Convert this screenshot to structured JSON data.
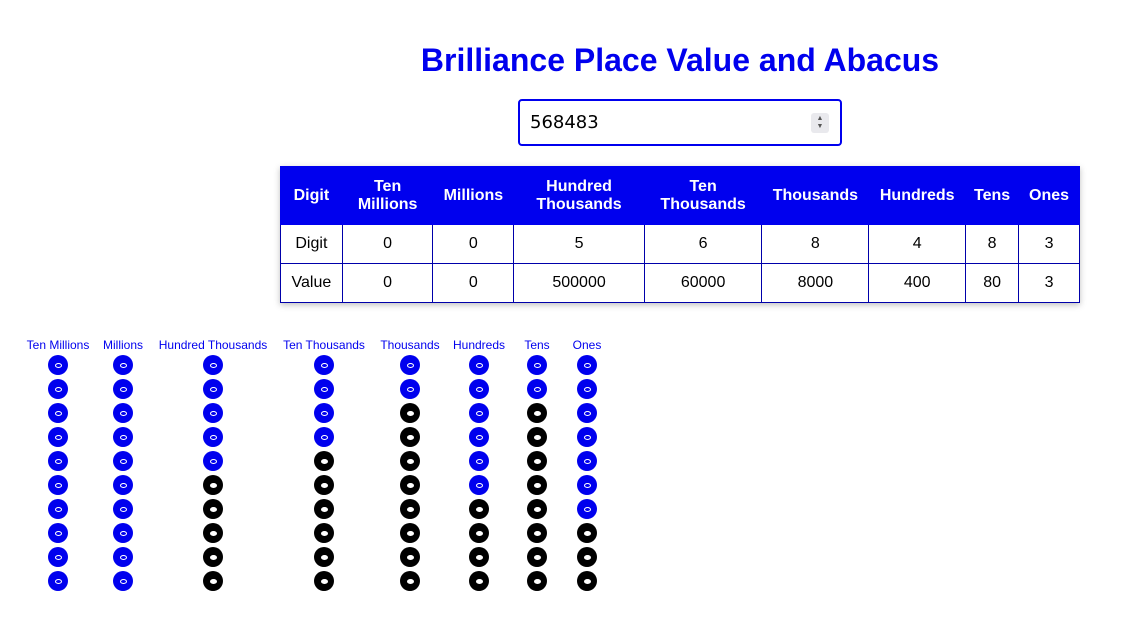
{
  "title": "Brilliance Place Value and Abacus",
  "input": {
    "value": "568483"
  },
  "table": {
    "headers": [
      "Digit",
      "Ten Millions",
      "Millions",
      "Hundred Thousands",
      "Ten Thousands",
      "Thousands",
      "Hundreds",
      "Tens",
      "Ones"
    ],
    "rows": [
      {
        "label": "Digit",
        "cells": [
          "0",
          "0",
          "5",
          "6",
          "8",
          "4",
          "8",
          "3"
        ]
      },
      {
        "label": "Value",
        "cells": [
          "0",
          "0",
          "500000",
          "60000",
          "8000",
          "400",
          "80",
          "3"
        ]
      }
    ]
  },
  "abacus": {
    "beads_per_column": 10,
    "columns": [
      {
        "label": "Ten Millions",
        "digit": 0
      },
      {
        "label": "Millions",
        "digit": 0
      },
      {
        "label": "Hundred Thousands",
        "digit": 5
      },
      {
        "label": "Ten Thousands",
        "digit": 6
      },
      {
        "label": "Thousands",
        "digit": 8
      },
      {
        "label": "Hundreds",
        "digit": 4
      },
      {
        "label": "Tens",
        "digit": 8
      },
      {
        "label": "Ones",
        "digit": 3
      }
    ],
    "colors": {
      "unused": "#0000ee",
      "counted": "#000000"
    }
  },
  "colors": {
    "accent": "#0000ee"
  }
}
